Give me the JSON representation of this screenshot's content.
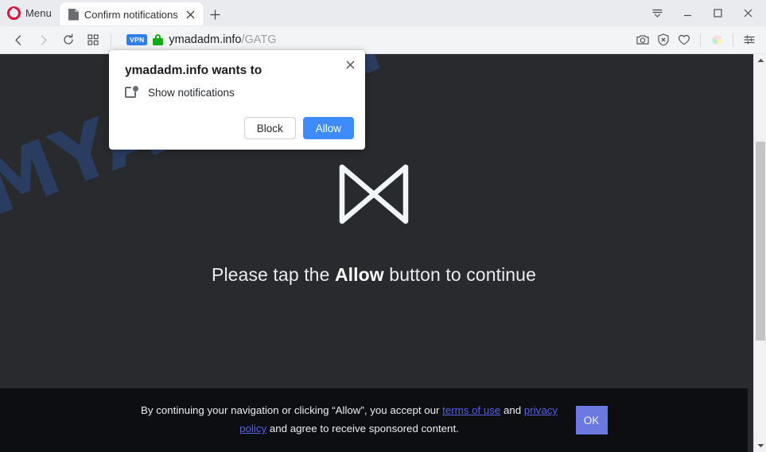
{
  "browser": {
    "menu_label": "Menu",
    "logo_icon": "opera-logo-icon",
    "tab": {
      "title": "Confirm notifications",
      "favicon": "page-document-icon",
      "close_icon": "close-icon"
    },
    "new_tab_icon": "plus-icon",
    "window_controls": {
      "tab_menu_icon": "tab-list-dropdown-icon",
      "minimize_icon": "minimize-icon",
      "maximize_icon": "maximize-icon",
      "close_icon": "close-icon"
    },
    "nav": {
      "back_icon": "back-arrow-icon",
      "forward_icon": "forward-arrow-icon",
      "reload_icon": "reload-icon",
      "speeddial_icon": "grid-squares-icon"
    },
    "address": {
      "vpn_badge": "VPN",
      "lock_icon": "padlock-secure-icon",
      "host": "ymadadm.info",
      "path": "/GATG"
    },
    "toolbar_icons": [
      "camera-snapshot-icon",
      "adblock-shield-icon",
      "heart-favorites-icon",
      "workspaces-cube-icon",
      "easy-setup-sliders-icon"
    ]
  },
  "dialog": {
    "title": "ymadadm.info wants to",
    "permission_icon": "notifications-icon",
    "permission_label": "Show notifications",
    "close_icon": "close-icon",
    "block_label": "Block",
    "allow_label": "Allow",
    "allow_color": "#3d8bfd"
  },
  "page": {
    "watermark": "MYANTISPYWARE.COM",
    "watermark_color": "#2b3f66",
    "background_color": "#282a2e",
    "spinner_icon": "bowtie-loading-spinner-icon",
    "tagline_before": "Please tap the ",
    "tagline_emphasis": "Allow",
    "tagline_after": " button to continue"
  },
  "consent": {
    "text_part1": "By continuing your navigation or clicking “Allow”, you accept our ",
    "link_terms": "terms of use",
    "text_part2": " and ",
    "link_privacy": "privacy policy",
    "text_part3": " and agree to receive sponsored content.",
    "ok_label": "OK",
    "ok_color": "#6b79e0",
    "background_color": "#0d0e11"
  },
  "scrollbar": {
    "up_icon": "scroll-up-arrow-icon",
    "down_icon": "scroll-down-arrow-icon",
    "thumb": "scrollbar-thumb"
  }
}
